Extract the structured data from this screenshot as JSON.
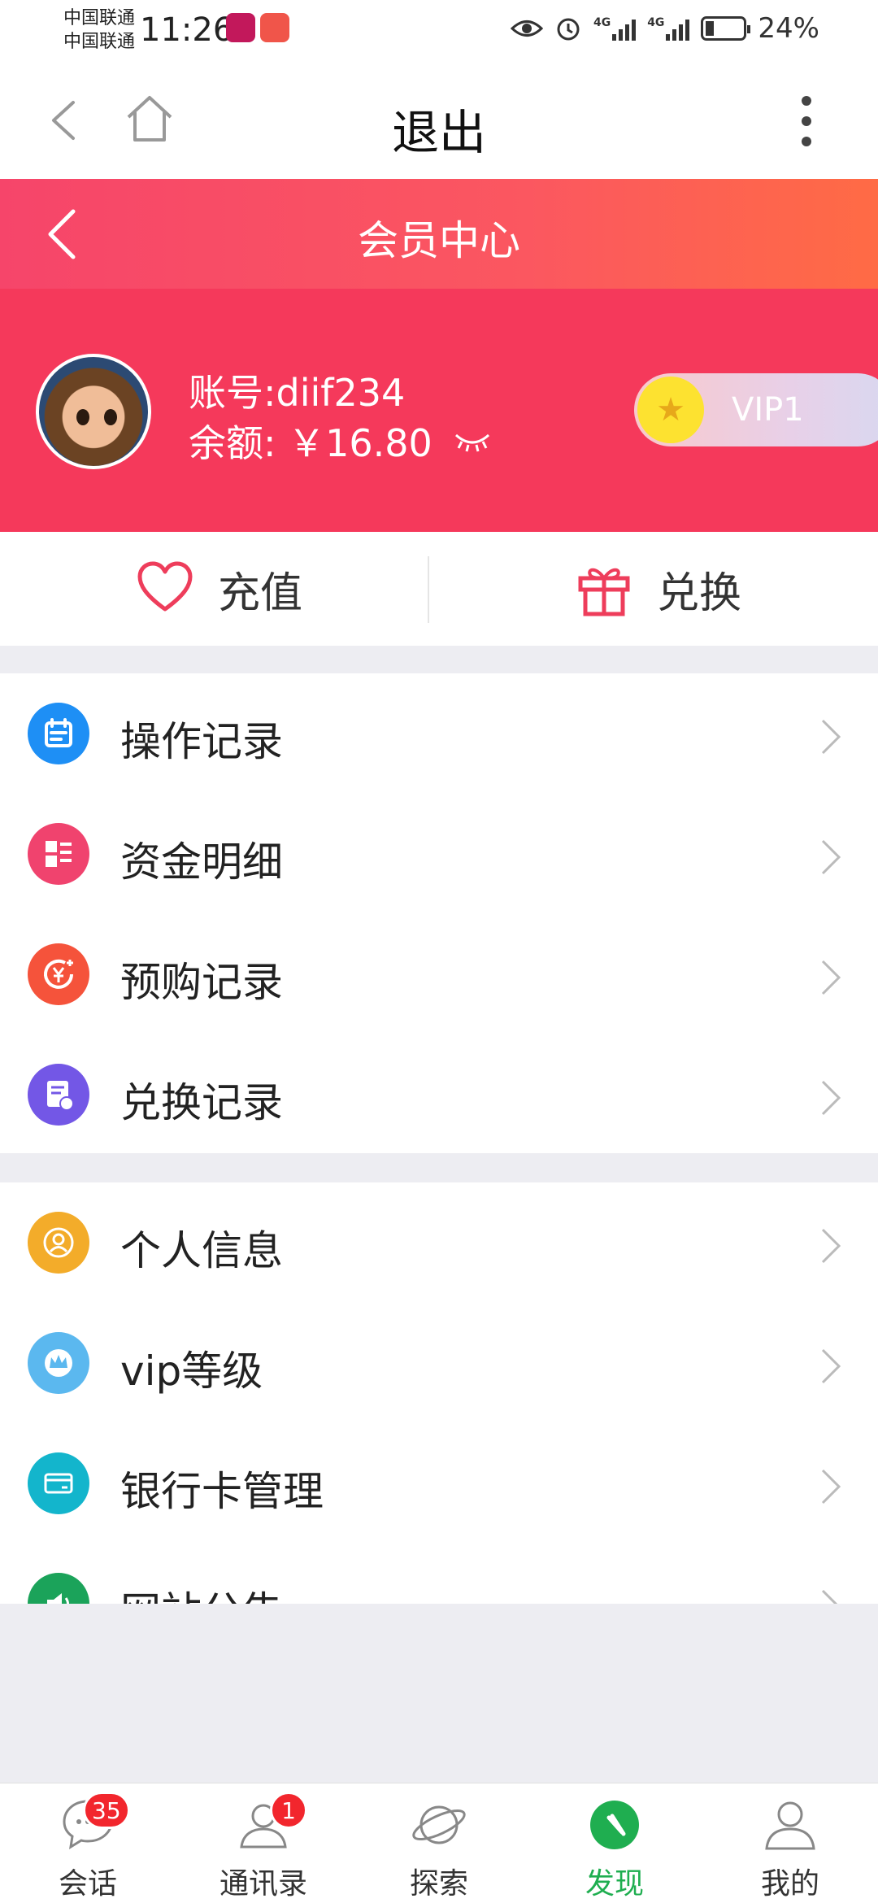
{
  "status_bar": {
    "carrier_1": "中国联通",
    "carrier_2": "中国联通",
    "time": "11:26",
    "network_1": "4G",
    "network_2": "4G",
    "battery": "24%"
  },
  "top_nav": {
    "title": "退出"
  },
  "member_header": {
    "title": "会员中心"
  },
  "profile": {
    "account": "账号:diif234",
    "balance": "余额: ￥16.80",
    "vip_level": "VIP1"
  },
  "actions": {
    "recharge": "充值",
    "exchange": "兑换"
  },
  "menu_group_1": [
    {
      "label": "操作记录",
      "icon": "calendar-icon",
      "color": "#1e8ff5"
    },
    {
      "label": "资金明细",
      "icon": "grid-list-icon",
      "color": "#f0436e"
    },
    {
      "label": "预购记录",
      "icon": "yuan-plus-icon",
      "color": "#f5533b"
    },
    {
      "label": "兑换记录",
      "icon": "document-exchange-icon",
      "color": "#7357e6"
    }
  ],
  "menu_group_2": [
    {
      "label": "个人信息",
      "icon": "user-circle-icon",
      "color": "#f3ac2a"
    },
    {
      "label": "vip等级",
      "icon": "crown-icon",
      "color": "#5bb8ef"
    },
    {
      "label": "银行卡管理",
      "icon": "bank-card-icon",
      "color": "#13b5cc"
    },
    {
      "label": "网站公告",
      "icon": "speaker-icon",
      "color": "#1ba35a"
    }
  ],
  "tabs": [
    {
      "label": "会话",
      "badge": "35",
      "icon": "chat-icon"
    },
    {
      "label": "通讯录",
      "badge": "1",
      "icon": "contacts-icon"
    },
    {
      "label": "探索",
      "badge": "",
      "icon": "planet-icon"
    },
    {
      "label": "发现",
      "badge": "",
      "icon": "compass-icon",
      "active": true
    },
    {
      "label": "我的",
      "badge": "",
      "icon": "profile-icon"
    }
  ],
  "colors": {
    "brand_pink": "#f5395b",
    "gradient_end": "#ff6b45",
    "active_tab": "#1fae50",
    "badge": "#f2262d"
  }
}
